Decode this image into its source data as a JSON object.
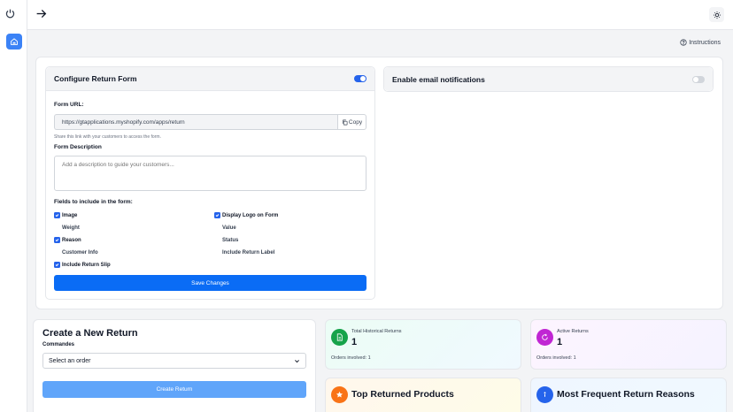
{
  "sidebar": {
    "logo_icon": "power-icon",
    "home_icon": "home-icon",
    "accent": "#3b82f6"
  },
  "topbar": {
    "back_icon": "arrow-right-icon",
    "theme_icon": "sun-icon"
  },
  "instructions": {
    "label": "Instructions",
    "icon": "help-circle-icon"
  },
  "return_form": {
    "title": "Configure Return Form",
    "enabled": true,
    "form_url_label": "Form URL:",
    "form_url_value": "https://gtapplications.myshopify.com/apps/return",
    "copy_label": "Copy",
    "share_help": "Share this link with your customers to access the form.",
    "description_label": "Form Description",
    "description_placeholder": "Add a description to guide your customers...",
    "fields_label": "Fields to include in the form:",
    "fields": [
      {
        "label": "Image",
        "checked": true
      },
      {
        "label": "Display Logo on Form",
        "checked": true
      },
      {
        "label": "Weight",
        "checked": false
      },
      {
        "label": "Value",
        "checked": false
      },
      {
        "label": "Reason",
        "checked": true
      },
      {
        "label": "Status",
        "checked": false
      },
      {
        "label": "Customer Info",
        "checked": false
      },
      {
        "label": "Include Return Label",
        "checked": false
      },
      {
        "label": "Include Return Slip",
        "checked": true
      }
    ],
    "save_label": "Save Changes"
  },
  "email_notifications": {
    "title": "Enable email notifications",
    "enabled": false
  },
  "create_return": {
    "title": "Create a New Return",
    "commandes_label": "Commandes",
    "select_value": "Select an order",
    "button_label": "Create Return"
  },
  "stats": {
    "total": {
      "label": "Total Historical Returns",
      "value": "1",
      "sub": "Orders involved: 1",
      "icon": "document-icon",
      "color": "#16a34a"
    },
    "active": {
      "label": "Active Returns",
      "value": "1",
      "sub": "Orders involved: 1",
      "icon": "refresh-icon",
      "color": "#c026d3"
    }
  },
  "sections": {
    "top_products": {
      "title": "Top Returned Products",
      "icon": "star-icon",
      "color": "#f97316"
    },
    "return_reasons": {
      "title": "Most Frequent Return Reasons",
      "icon": "info-icon",
      "color": "#2563eb"
    }
  }
}
